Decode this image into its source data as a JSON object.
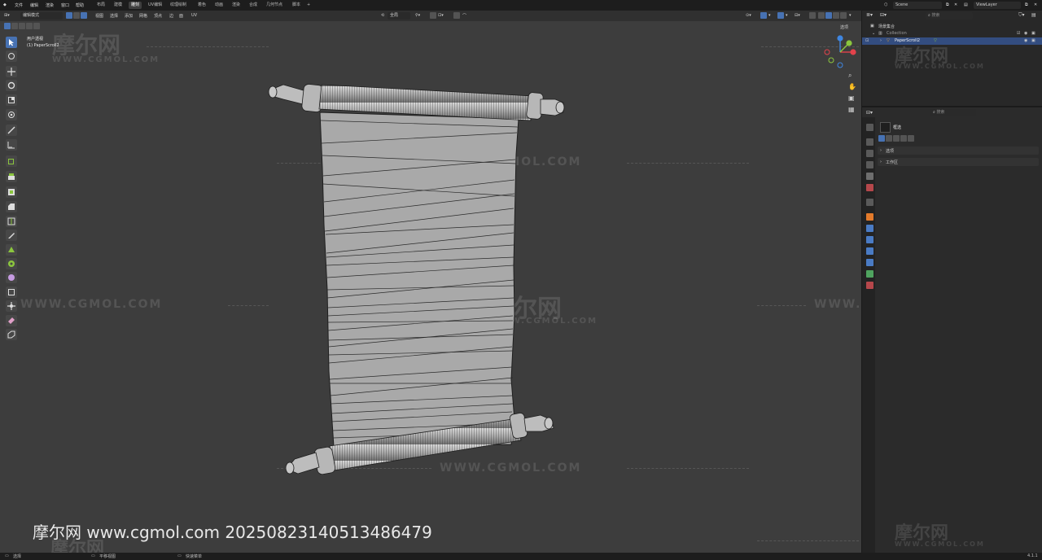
{
  "menu": {
    "file": "文件",
    "edit": "编辑",
    "render": "渲染",
    "window": "窗口",
    "help": "帮助"
  },
  "workspaces": [
    "布局",
    "建模",
    "雕刻",
    "UV编辑",
    "纹理绘制",
    "着色",
    "动画",
    "渲染",
    "合成",
    "几何节点",
    "脚本",
    "+"
  ],
  "active_workspace_index": 2,
  "scene": {
    "name": "Scene",
    "view_layer": "ViewLayer"
  },
  "viewport_header": {
    "mode": "编辑模式",
    "menus": [
      "视图",
      "选择",
      "添加",
      "网格",
      "顶点",
      "边",
      "面",
      "UV"
    ],
    "transform_orientation": "全局",
    "options": "选项"
  },
  "viewport": {
    "view_name": "用户透视",
    "object_label": "(1) PaperScroll2"
  },
  "outliner": {
    "search_placeholder": "搜索",
    "scene_collection": "场景集合",
    "collection": "Collection",
    "object": "PaperScroll2"
  },
  "properties": {
    "search_placeholder": "搜索",
    "tool_title": "框选",
    "panels": [
      "选项",
      "工作区"
    ]
  },
  "status_bar": {
    "select": "选择",
    "pan_view": "平移视图",
    "context_menu": "快速菜单",
    "version": "4.1.1"
  },
  "watermarks": {
    "brand_cn": "摩尔网",
    "url": "WWW.CGMOL.COM",
    "bottom_caption": "摩尔网 www.cgmol.com 20250823140513486479"
  },
  "colors": {
    "accent": "#4772b3",
    "axis_x": "#e2424b",
    "axis_y": "#8bc63e",
    "axis_z": "#3f86e0"
  },
  "toolbar_tools": [
    "select-box",
    "cursor",
    "move",
    "rotate",
    "scale",
    "transform",
    "annotate",
    "measure",
    "add-cube",
    "extrude",
    "inset",
    "bevel",
    "loop-cut",
    "knife",
    "poly-build",
    "spin",
    "smooth",
    "shrink-fatten",
    "shear",
    "rip",
    "vertex-slide"
  ]
}
